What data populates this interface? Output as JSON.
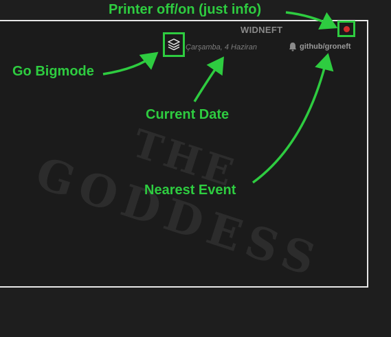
{
  "widget": {
    "title": "WIDNEFT",
    "date": "Çarşamba, 4 Haziran",
    "nearest_event": "github/groneft",
    "watermark_line1": "THE",
    "watermark_line2": "GODDESS"
  },
  "icons": {
    "bigmode": "layers-icon",
    "event": "bell-icon",
    "printer": "status-dot-icon"
  },
  "colors": {
    "annotation": "#2ecc40",
    "printer_status": "#d42b2b",
    "frame": "#e8e8e8",
    "background": "#1e1e1e"
  },
  "annotations": {
    "printer": "Printer off/on (just info)",
    "bigmode": "Go Bigmode",
    "date": "Current Date",
    "event": "Nearest Event"
  }
}
